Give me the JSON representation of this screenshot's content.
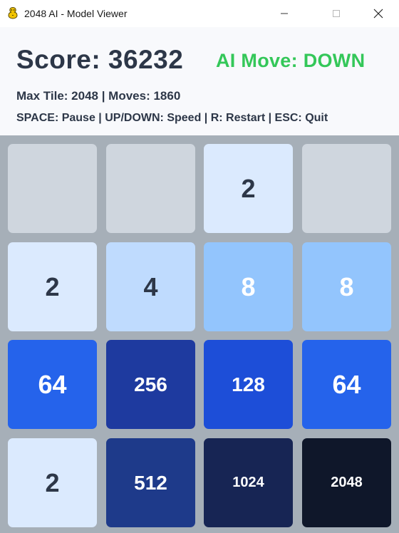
{
  "window": {
    "title": "2048 AI - Model Viewer",
    "icon": "pygame-snake-icon",
    "buttons": {
      "minimize_icon": "minimize-icon",
      "maximize_icon": "maximize-icon",
      "close_icon": "close-icon"
    }
  },
  "header": {
    "score_text": "Score: 36232",
    "ai_move_text": "AI Move: DOWN",
    "stats_text": "Max Tile: 2048 | Moves: 1860",
    "controls_text": "SPACE: Pause | UP/DOWN: Speed | R: Restart | ESC: Quit"
  },
  "colors": {
    "background": "#f8f9fc",
    "text": "#2d3748",
    "ai_move": "#34c759",
    "board": "#a6afb8"
  },
  "board": {
    "rows": 4,
    "cols": 4,
    "tiles": [
      [
        {
          "value": "",
          "bg": "#cfd6de",
          "fg": "#2d3748"
        },
        {
          "value": "",
          "bg": "#cfd6de",
          "fg": "#2d3748"
        },
        {
          "value": "2",
          "bg": "#dbeafe",
          "fg": "#2d3748"
        },
        {
          "value": "",
          "bg": "#cfd6de",
          "fg": "#2d3748"
        }
      ],
      [
        {
          "value": "2",
          "bg": "#dbeafe",
          "fg": "#2d3748"
        },
        {
          "value": "4",
          "bg": "#bfdbfe",
          "fg": "#2d3748"
        },
        {
          "value": "8",
          "bg": "#93c5fd",
          "fg": "#ffffff"
        },
        {
          "value": "8",
          "bg": "#93c5fd",
          "fg": "#ffffff"
        }
      ],
      [
        {
          "value": "64",
          "bg": "#2563eb",
          "fg": "#ffffff"
        },
        {
          "value": "256",
          "bg": "#1e3a9f",
          "fg": "#ffffff"
        },
        {
          "value": "128",
          "bg": "#1d4ed8",
          "fg": "#ffffff"
        },
        {
          "value": "64",
          "bg": "#2563eb",
          "fg": "#ffffff"
        }
      ],
      [
        {
          "value": "2",
          "bg": "#dbeafe",
          "fg": "#2d3748"
        },
        {
          "value": "512",
          "bg": "#1e3a8a",
          "fg": "#ffffff"
        },
        {
          "value": "1024",
          "bg": "#172554",
          "fg": "#ffffff"
        },
        {
          "value": "2048",
          "bg": "#0f172a",
          "fg": "#ffffff"
        }
      ]
    ]
  }
}
